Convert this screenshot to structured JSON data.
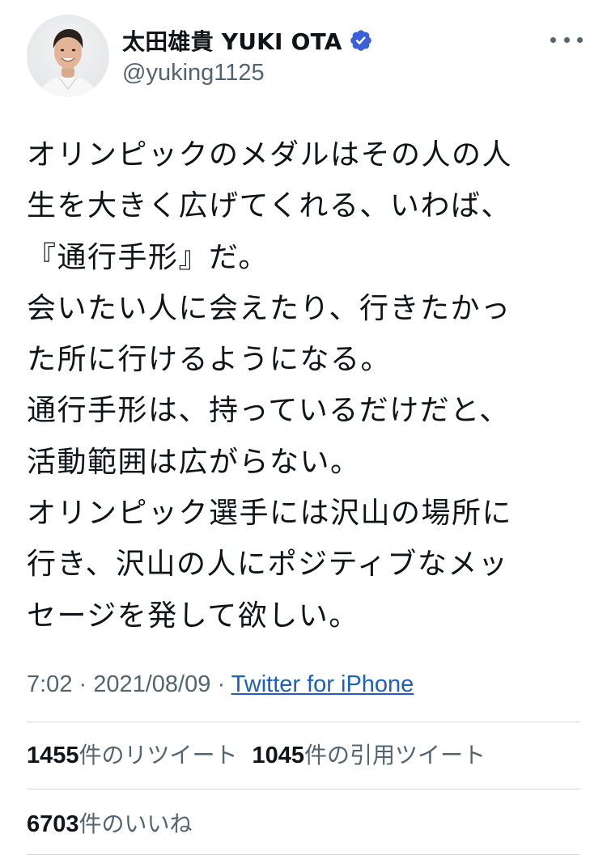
{
  "author": {
    "display_name": "太田雄貴 YUKI OTA",
    "handle": "@yuking1125",
    "verified": true,
    "avatar_icon": "profile-photo"
  },
  "tweet": {
    "lines": [
      "オリンピックのメダルはその人の人",
      "生を大きく広げてくれる、いわば、",
      "『通行手形』だ。",
      "会いたい人に会えたり、行きたかっ",
      "た所に行けるようになる。",
      "通行手形は、持っているだけだと、",
      "活動範囲は広がらない。",
      "オリンピック選手には沢山の場所に",
      "行き、沢山の人にポジティブなメッ",
      "セージを発して欲しい。"
    ]
  },
  "meta": {
    "time": "7:02",
    "separator": " · ",
    "date": "2021/08/09",
    "source": "Twitter for iPhone"
  },
  "stats": {
    "retweets_count": "1455",
    "retweets_label": "件のリツイート",
    "quotes_count": "1045",
    "quotes_label": "件の引用ツイート",
    "likes_count": "6703",
    "likes_label": "件のいいね"
  },
  "colors": {
    "text": "#0f1419",
    "secondary": "#536471",
    "link": "#1d5fbf",
    "verified": "#3b5fd6",
    "divider": "#cfd9de"
  }
}
